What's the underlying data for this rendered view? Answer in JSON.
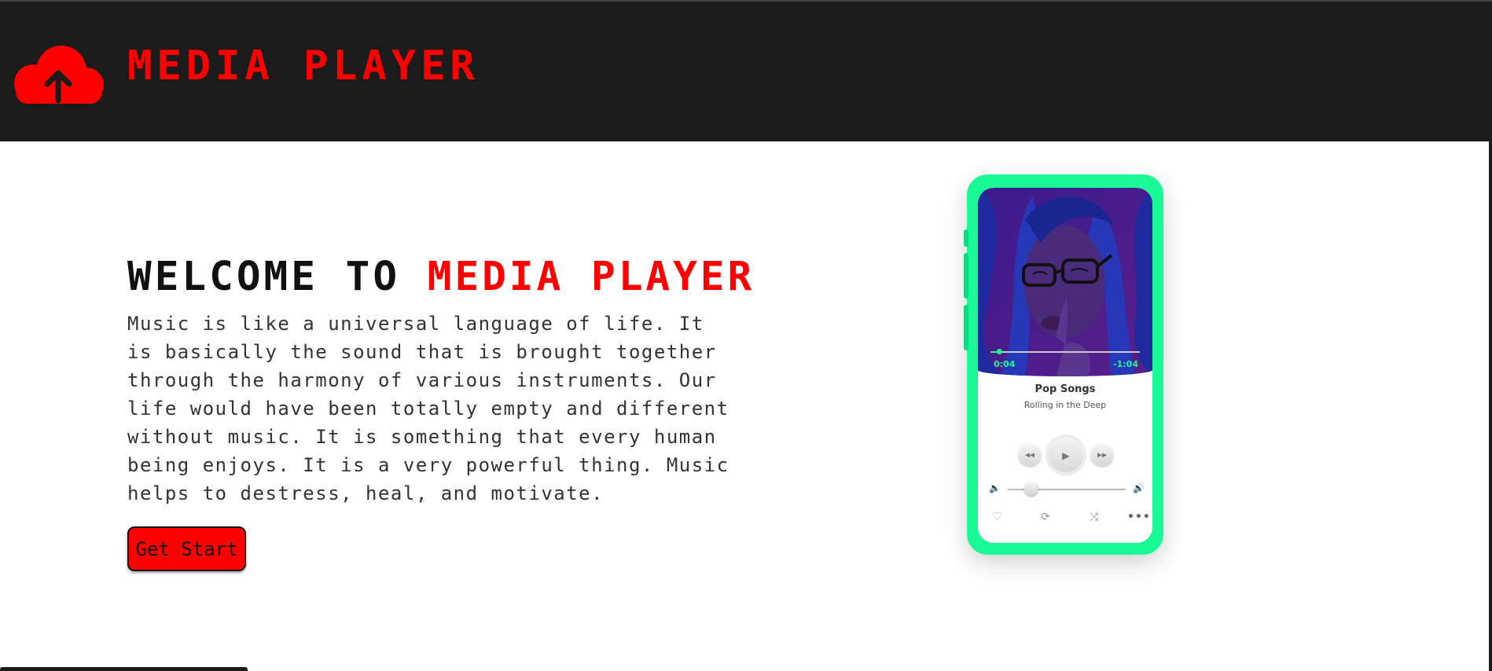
{
  "header": {
    "brand": "MEDIA PLAYER",
    "logo_icon": "cloud-upload-icon",
    "background": "#1b1b1b",
    "accent": "#ff0000"
  },
  "hero": {
    "title_prefix": "WELCOME TO ",
    "title_accent": "MEDIA PLAYER",
    "description": "Music is like a universal language of life. It is basically the sound that is brought together through the harmony of various instruments. Our life would have been totally empty and different without music. It is something that every human being enjoys. It is a very powerful thing. Music helps to destress, heal, and motivate.",
    "cta_label": "Get Start"
  },
  "player": {
    "frame_color": "#19fa97",
    "elapsed": "0:04",
    "remaining": "-1:04",
    "progress": 0.06,
    "title": "Pop Songs",
    "subtitle": "Rolling in the Deep",
    "volume": 0.2,
    "controls": {
      "rewind_icon": "rewind-icon",
      "play_icon": "play-icon",
      "forward_icon": "fast-forward-icon",
      "volume_low_icon": "volume-mute-icon",
      "volume_high_icon": "volume-high-icon",
      "heart_icon": "heart-icon",
      "repeat_icon": "repeat-icon",
      "shuffle_icon": "shuffle-icon",
      "more_icon": "more-icon"
    }
  }
}
